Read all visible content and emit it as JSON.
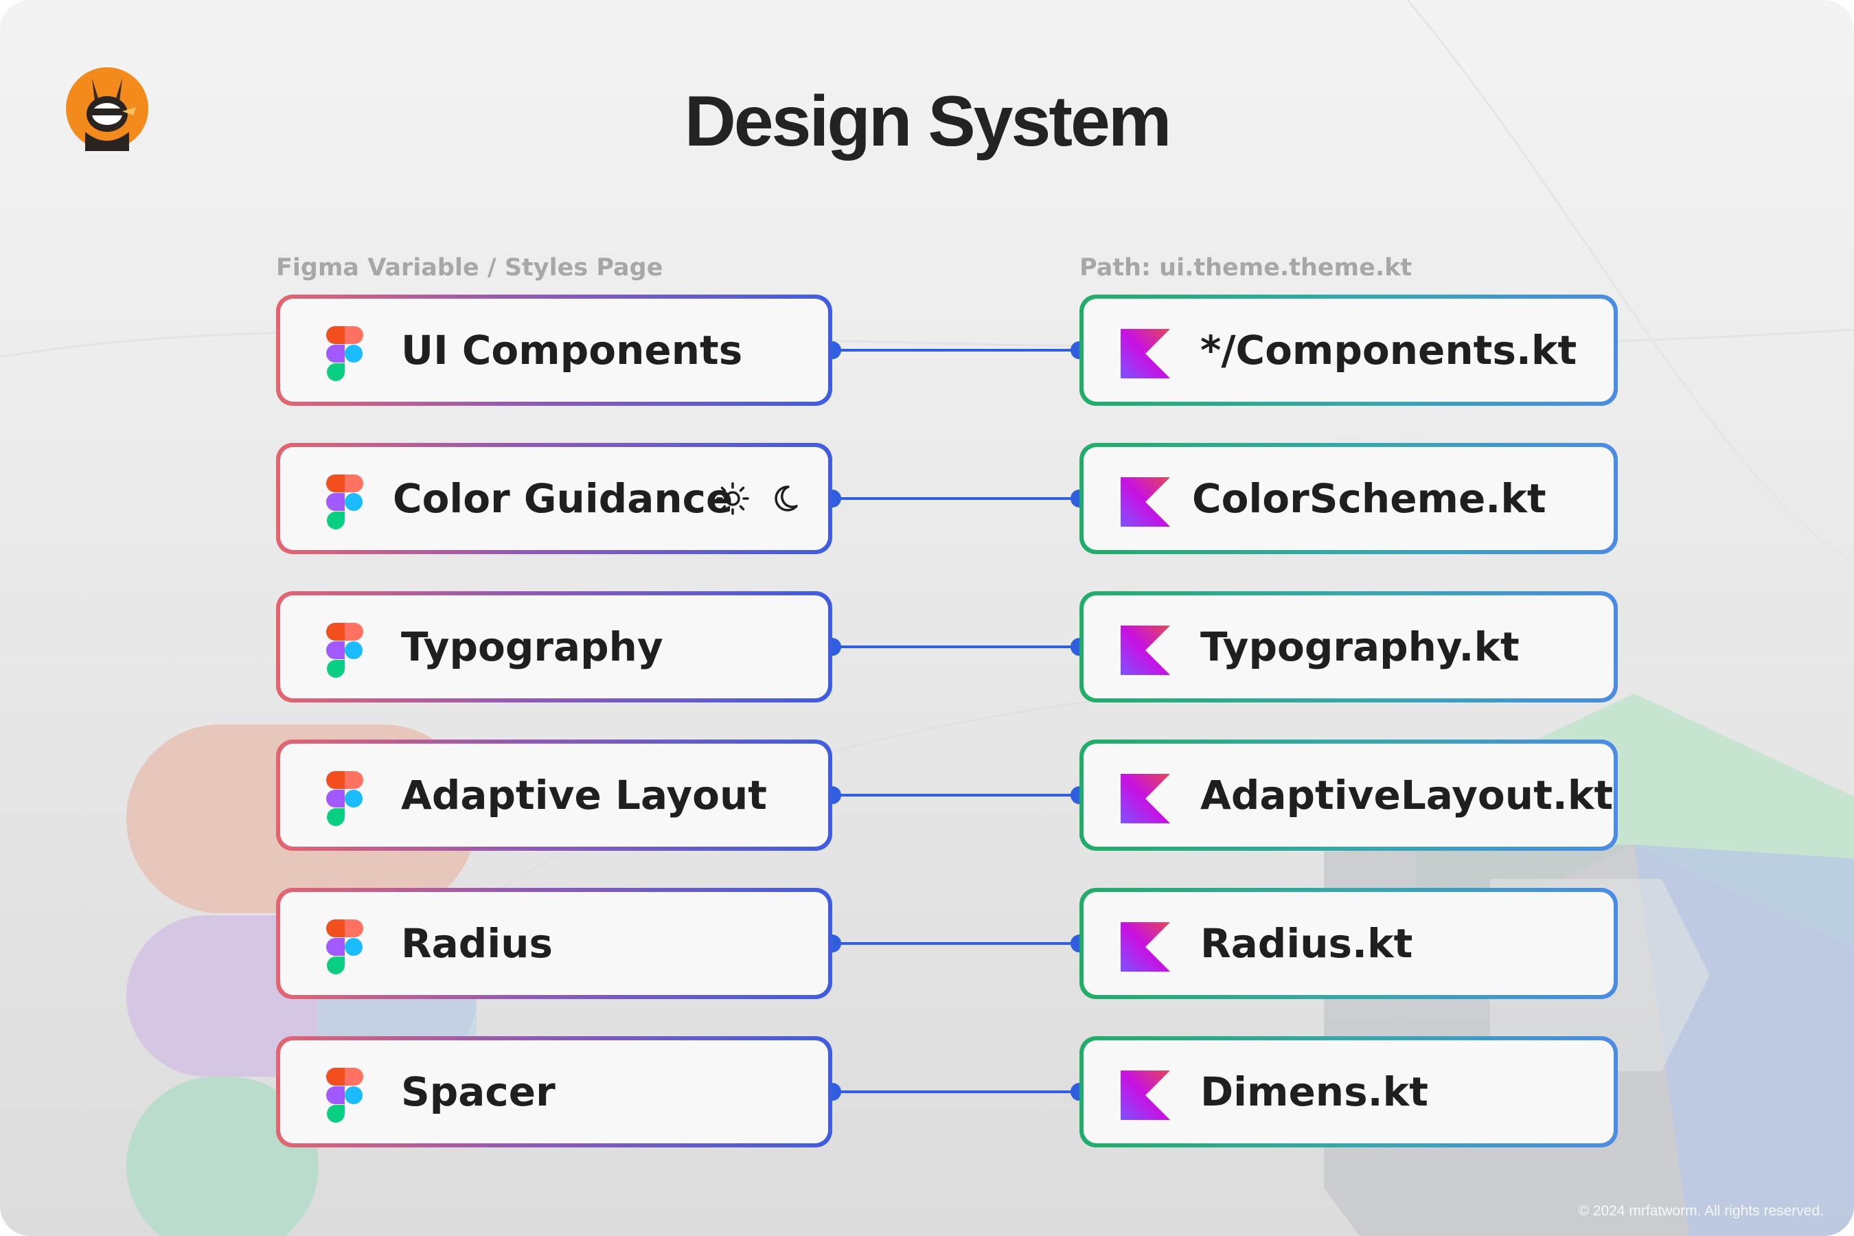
{
  "title": "Design System",
  "left_column_label": "Figma Variable / Styles Page",
  "right_column_label": "Path: ui.theme.theme.kt",
  "rows": [
    {
      "figma": "UI Components",
      "kotlin": "*/Components.kt"
    },
    {
      "figma": "Color Guidance",
      "kotlin": "ColorScheme.kt"
    },
    {
      "figma": "Typography",
      "kotlin": "Typography.kt"
    },
    {
      "figma": "Adaptive Layout",
      "kotlin": "AdaptiveLayout.kt"
    },
    {
      "figma": "Radius",
      "kotlin": "Radius.kt"
    },
    {
      "figma": "Spacer",
      "kotlin": "Dimens.kt"
    }
  ],
  "icons": {
    "avatar": "bunny-ninja-avatar-icon",
    "figma": "figma-logo-icon",
    "kotlin": "kotlin-logo-icon",
    "light_mode": "sun-icon",
    "dark_mode": "moon-icon"
  },
  "colors": {
    "left_border": [
      "#e4646f",
      "#3f5de0"
    ],
    "right_border": [
      "#21ad68",
      "#4a8be4"
    ],
    "connector": "#2f5fde",
    "title": "#232323"
  },
  "copyright": "© 2024 mrfatworm. All rights reserved."
}
